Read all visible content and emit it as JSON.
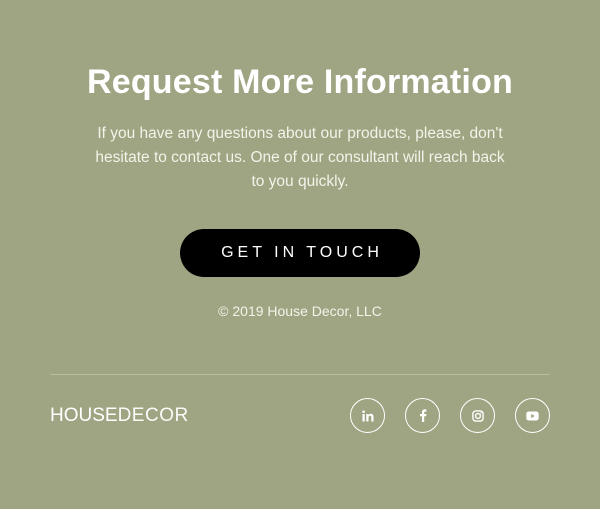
{
  "cta": {
    "title": "Request More Information",
    "description": "If you have any questions about our products, please, don't hesitate to contact us. One of our consultant will reach back to you quickly.",
    "button_label": "GET IN TOUCH",
    "copyright": "© 2019 House Decor, LLC"
  },
  "footer": {
    "logo_part1": "HOUSE",
    "logo_part2": "DECOR",
    "social": [
      {
        "icon": "linkedin-icon"
      },
      {
        "icon": "facebook-icon"
      },
      {
        "icon": "instagram-icon"
      },
      {
        "icon": "youtube-icon"
      }
    ]
  },
  "colors": {
    "background": "#9fa582",
    "button": "#000000",
    "text": "#ffffff"
  }
}
